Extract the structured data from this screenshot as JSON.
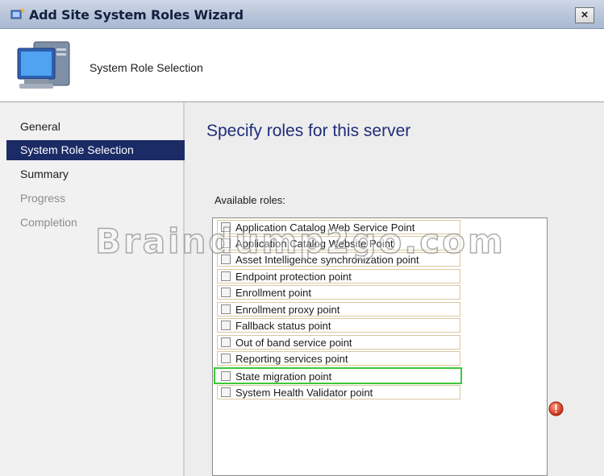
{
  "window": {
    "title": "Add Site System Roles Wizard",
    "close_glyph": "×"
  },
  "header": {
    "title": "System Role Selection",
    "icon": "computer-monitor-icon"
  },
  "sidebar": {
    "items": [
      {
        "label": "General",
        "state": "normal"
      },
      {
        "label": "System Role Selection",
        "state": "active"
      },
      {
        "label": "Summary",
        "state": "normal"
      },
      {
        "label": "Progress",
        "state": "disabled"
      },
      {
        "label": "Completion",
        "state": "disabled"
      }
    ]
  },
  "main": {
    "heading": "Specify roles for this server",
    "roles_label": "Available roles:",
    "roles": [
      {
        "label": "Application Catalog Web Service Point",
        "checked": false
      },
      {
        "label": "Application Catalog Website Point",
        "checked": false
      },
      {
        "label": "Asset Intelligence synchronization point",
        "checked": false
      },
      {
        "label": "Endpoint protection point",
        "checked": false
      },
      {
        "label": "Enrollment point",
        "checked": false
      },
      {
        "label": "Enrollment proxy point",
        "checked": false
      },
      {
        "label": "Fallback status point",
        "checked": false
      },
      {
        "label": "Out of band service point",
        "checked": false
      },
      {
        "label": "Reporting services point",
        "checked": false
      },
      {
        "label": "State migration point",
        "checked": false,
        "highlighted": true
      },
      {
        "label": "System Health Validator point",
        "checked": false
      }
    ]
  },
  "watermark": "Braindump2go.com",
  "colors": {
    "active_nav": "#1b2b66",
    "heading": "#1f2e7a",
    "highlight": "#3cc83c",
    "warning": "#d8402a"
  }
}
